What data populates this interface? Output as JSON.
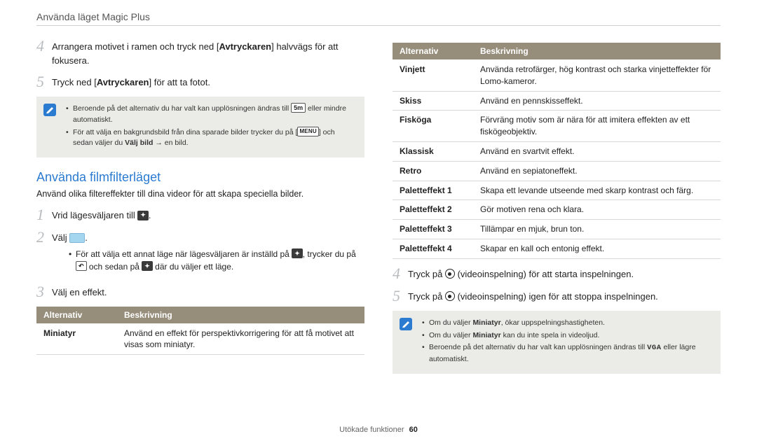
{
  "header": "Använda läget Magic Plus",
  "left": {
    "step4": {
      "n": "4",
      "pre": "Arrangera motivet i ramen och tryck ned [",
      "bold": "Avtryckaren",
      "post": "] halvvägs för att fokusera."
    },
    "step5": {
      "n": "5",
      "pre": "Tryck ned [",
      "bold": "Avtryckaren",
      "post": "] för att ta fotot."
    },
    "note1": {
      "line1a": "Beroende på det alternativ du har valt kan upplösningen ändras till ",
      "chip1": "5m",
      "line1b": " eller mindre automatiskt.",
      "line2a": "För att välja en bakgrundsbild från dina sparade bilder trycker du på [",
      "chip2": "MENU",
      "line2b": "] och sedan väljer du ",
      "bold": "Välj bild",
      "line2c": " → en bild."
    },
    "section_heading": "Använda filmfilterläget",
    "section_sub": "Använd olika filtereffekter till dina videor för att skapa speciella bilder.",
    "s1": {
      "n": "1",
      "text": "Vrid lägesväljaren till "
    },
    "s2": {
      "n": "2",
      "text": "Välj "
    },
    "s2_bullet": {
      "a": "För att välja ett annat läge när lägesväljaren är inställd på ",
      "b": ", trycker du på ",
      "c": " och sedan på ",
      "d": " där du väljer ett läge."
    },
    "s3": {
      "n": "3",
      "text": "Välj en effekt."
    },
    "table": {
      "h1": "Alternativ",
      "h2": "Beskrivning",
      "rows": [
        {
          "a": "Miniatyr",
          "b": "Använd en effekt för perspektivkorrigering för att få motivet att visas som miniatyr."
        }
      ]
    }
  },
  "right": {
    "table": {
      "h1": "Alternativ",
      "h2": "Beskrivning",
      "rows": [
        {
          "a": "Vinjett",
          "b": "Använda retrofärger, hög kontrast och starka vinjetteffekter för Lomo-kameror."
        },
        {
          "a": "Skiss",
          "b": "Använd en pennskisseffekt."
        },
        {
          "a": "Fisköga",
          "b": "Förvräng motiv som är nära för att imitera effekten av ett fiskögeobjektiv."
        },
        {
          "a": "Klassisk",
          "b": "Använd en svartvit effekt."
        },
        {
          "a": "Retro",
          "b": "Använd en sepiatoneffekt."
        },
        {
          "a": "Paletteffekt 1",
          "b": "Skapa ett levande utseende med skarp kontrast och färg."
        },
        {
          "a": "Paletteffekt 2",
          "b": "Gör motiven rena och klara."
        },
        {
          "a": "Paletteffekt 3",
          "b": "Tillämpar en mjuk, brun ton."
        },
        {
          "a": "Paletteffekt 4",
          "b": "Skapar en kall och entonig effekt."
        }
      ]
    },
    "step4": {
      "n": "4",
      "pre": "Tryck på ",
      "post": " (videoinspelning) för att starta inspelningen."
    },
    "step5": {
      "n": "5",
      "pre": "Tryck på ",
      "post": " (videoinspelning) igen för att stoppa inspelningen."
    },
    "note2": {
      "l1a": "Om du väljer ",
      "l1bold": "Miniatyr",
      "l1b": ", ökar uppspelningshastigheten.",
      "l2a": "Om du väljer ",
      "l2bold": "Miniatyr",
      "l2b": " kan du inte spela in videoljud.",
      "l3a": "Beroende på det alternativ du har valt kan upplösningen ändras till ",
      "l3chip": "VGA",
      "l3b": " eller lägre automatiskt."
    }
  },
  "footer": {
    "text": "Utökade funktioner",
    "page": "60"
  }
}
